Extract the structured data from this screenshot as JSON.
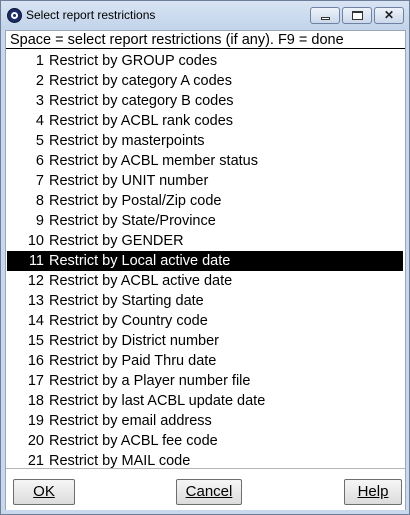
{
  "window": {
    "title": "Select report restrictions",
    "minimize_icon": "minimize-icon",
    "maximize_icon": "maximize-icon",
    "close_icon": "close-icon",
    "close_glyph": "✕"
  },
  "header": {
    "instruction": "Space = select report restrictions (if any).  F9 = done"
  },
  "list": {
    "selected_index": 10,
    "items": [
      {
        "num": "1",
        "label": "Restrict by GROUP codes"
      },
      {
        "num": "2",
        "label": "Restrict by category A codes"
      },
      {
        "num": "3",
        "label": "Restrict by category B codes"
      },
      {
        "num": "4",
        "label": "Restrict by ACBL rank codes"
      },
      {
        "num": "5",
        "label": "Restrict by masterpoints"
      },
      {
        "num": "6",
        "label": "Restrict by ACBL member status"
      },
      {
        "num": "7",
        "label": "Restrict by UNIT number"
      },
      {
        "num": "8",
        "label": "Restrict by Postal/Zip code"
      },
      {
        "num": "9",
        "label": "Restrict by State/Province"
      },
      {
        "num": "10",
        "label": "Restrict by GENDER"
      },
      {
        "num": "11",
        "label": "Restrict by Local active date"
      },
      {
        "num": "12",
        "label": "Restrict by ACBL active date"
      },
      {
        "num": "13",
        "label": "Restrict by Starting date"
      },
      {
        "num": "14",
        "label": "Restrict by Country code"
      },
      {
        "num": "15",
        "label": "Restrict by District number"
      },
      {
        "num": "16",
        "label": "Restrict by Paid Thru date"
      },
      {
        "num": "17",
        "label": "Restrict by a Player number file"
      },
      {
        "num": "18",
        "label": "Restrict by last ACBL update date"
      },
      {
        "num": "19",
        "label": "Restrict by email address"
      },
      {
        "num": "20",
        "label": "Restrict by ACBL fee code"
      },
      {
        "num": "21",
        "label": "Restrict by MAIL code"
      }
    ]
  },
  "buttons": {
    "ok": "OK",
    "cancel": "Cancel",
    "help": "Help"
  }
}
